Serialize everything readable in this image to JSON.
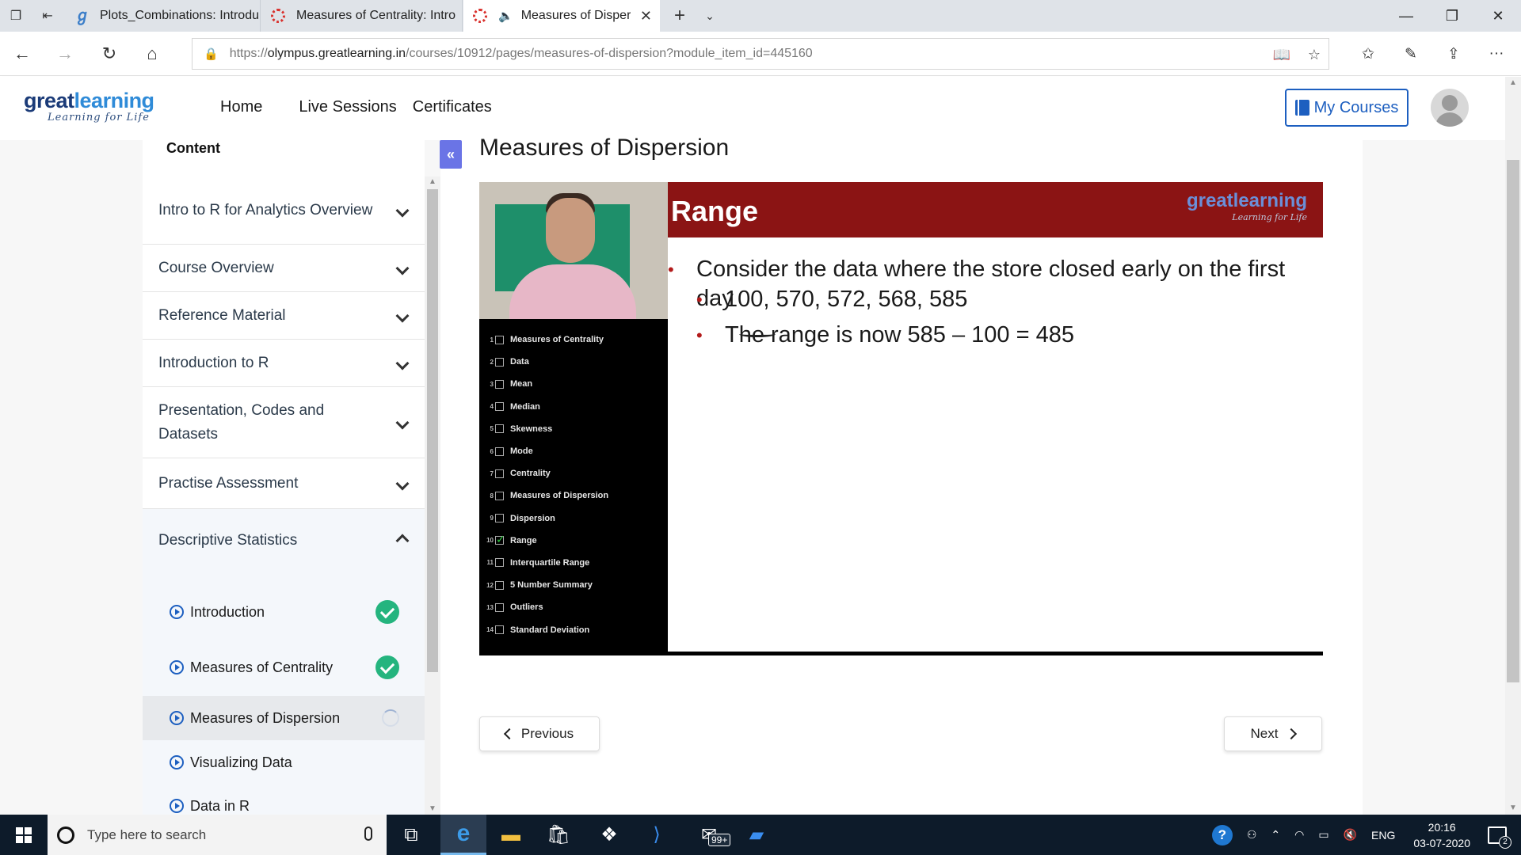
{
  "browser": {
    "tabs": [
      {
        "label": "Plots_Combinations: Introdu",
        "favicon": "gl-icon"
      },
      {
        "label": "Measures of Centrality: Intro",
        "favicon": "loading-ring-icon"
      },
      {
        "label": "Measures of Disper",
        "favicon": "loading-ring-icon",
        "active": true,
        "audio": true
      }
    ],
    "url": {
      "scheme": "https://",
      "host": "olympus.greatlearning.in",
      "path": "/courses/10912/pages/measures-of-dispersion?module_item_id=445160"
    }
  },
  "site": {
    "logo": {
      "part1": "great",
      "part2": "learning",
      "tagline": "Learning for Life"
    },
    "nav": [
      "Home",
      "Live Sessions",
      "Certificates"
    ],
    "my_courses": "My Courses"
  },
  "sidebar": {
    "heading": "Content",
    "modules": [
      {
        "label": "Intro to R for Analytics Overview"
      },
      {
        "label": "Course Overview"
      },
      {
        "label": "Reference Material"
      },
      {
        "label": "Introduction to R"
      },
      {
        "label": "Presentation, Codes and Datasets"
      },
      {
        "label": "Practise Assessment"
      },
      {
        "label": "Descriptive Statistics",
        "expanded": true
      }
    ],
    "lessons": [
      {
        "label": "Introduction",
        "status": "complete"
      },
      {
        "label": "Measures of Centrality",
        "status": "complete"
      },
      {
        "label": "Measures of Dispersion",
        "status": "in-progress"
      },
      {
        "label": "Visualizing Data",
        "status": "none"
      },
      {
        "label": "Data in R",
        "status": "none"
      }
    ]
  },
  "main": {
    "title": "Measures of Dispersion",
    "slide": {
      "title": "Range",
      "logo_main": "greatlearning",
      "logo_tag": "Learning for Life",
      "bullet1": "Consider the data where the store closed early on the first day",
      "sub1": "100, 570, 572, 568, 585",
      "sub2": "The range is now 585 – 100 = 485"
    },
    "toc": [
      "Measures of Centrality",
      "Data",
      "Mean",
      "Median",
      "Skewness",
      "Mode",
      "Centrality",
      "Measures of Dispersion",
      "Dispersion",
      "Range",
      "Interquartile Range",
      "5 Number Summary",
      "Outliers",
      "Standard Deviation"
    ],
    "toc_checked_index": 10,
    "previous": "Previous",
    "next": "Next"
  },
  "taskbar": {
    "search_placeholder": "Type here to search",
    "badge": "99+",
    "lang": "ENG",
    "time": "20:16",
    "date": "03-07-2020",
    "notifications": "2"
  },
  "colors": {
    "brand_blue": "#1d5fc0",
    "check_green": "#24b47e",
    "slide_red": "#8b1414",
    "collapse_purple": "#6a74e6"
  }
}
